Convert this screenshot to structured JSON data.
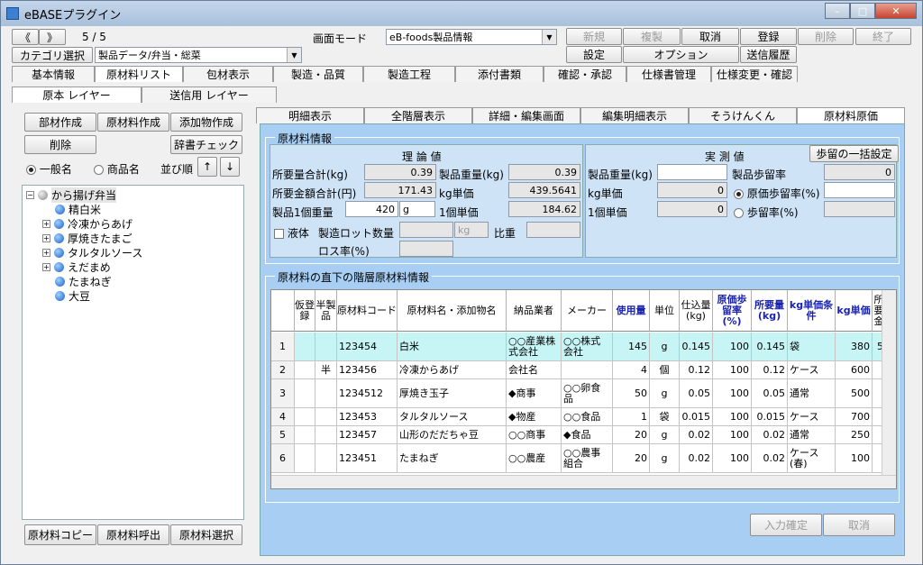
{
  "window": {
    "title": "eBASEプラグイン",
    "min": "–",
    "max": "□",
    "close": "✕"
  },
  "toolbar": {
    "prev": "《",
    "next": "》",
    "record": "5 / 5",
    "mode_label": "画面モード",
    "mode_value": "eB-foods製品情報",
    "category_btn": "カテゴリ選択",
    "category_value": "製品データ/弁当・総菜",
    "btn_new": "新規",
    "btn_copy": "複製",
    "btn_cancel": "取消",
    "btn_register": "登録",
    "btn_delete": "削除",
    "btn_exit": "終了",
    "btn_settings": "設定",
    "btn_option": "オプション",
    "btn_history": "送信履歴"
  },
  "main_tabs": [
    "基本情報",
    "原材料リスト",
    "包材表示",
    "製造・品質",
    "製造工程",
    "添付書類",
    "確認・承認",
    "仕様書管理",
    "仕様変更・確認"
  ],
  "layer_tabs": [
    "原本 レイヤー",
    "送信用 レイヤー"
  ],
  "left": {
    "btn_material": "部材作成",
    "btn_raw": "原材料作成",
    "btn_additive": "添加物作成",
    "btn_delete": "削除",
    "btn_dict": "辞書チェック",
    "radio_general": "一般名",
    "radio_product": "商品名",
    "sort_label": "並び順",
    "up": "↑",
    "down": "↓",
    "tree_root": "から揚げ弁当",
    "tree_items": [
      "精白米",
      "冷凍からあげ",
      "厚焼きたまご",
      "タルタルソース",
      "えだまめ",
      "たまねぎ",
      "大豆"
    ],
    "btn_raw_copy": "原材料コピー",
    "btn_raw_call": "原材料呼出",
    "btn_raw_select": "原材料選択"
  },
  "sub_tabs": [
    "明細表示",
    "全階層表示",
    "詳細・編集画面",
    "編集明細表示",
    "そうけんくん",
    "原材料原価"
  ],
  "info": {
    "group_title": "原材料情報",
    "theory": "理 論 値",
    "actual": "実 測 値",
    "btn_yield": "歩留の一括設定",
    "req_total_kg": "所要量合計(kg)",
    "req_total_kg_val": "0.39",
    "prod_weight_kg": "製品重量(kg)",
    "prod_weight_kg_val": "0.39",
    "req_amount": "所要金額合計(円)",
    "req_amount_val": "171.43",
    "kg_price": "kg単価",
    "kg_price_val": "439.5641",
    "unit_weight": "製品1個重量",
    "unit_weight_val": "420",
    "unit_weight_unit": "g",
    "unit_price": "1個単価",
    "unit_price_val": "184.62",
    "liquid": "液体",
    "lot": "製造ロット数量",
    "lot_unit": "kg",
    "gravity": "比重",
    "loss": "ロス率(%)",
    "a_prod_weight": "製品重量(kg)",
    "a_kg_price": "kg単価",
    "a_kg_price_val": "0",
    "a_unit_price": "1個単価",
    "a_unit_price_val": "0",
    "a_yield": "製品歩留率",
    "a_yield_val": "0",
    "a_cost_yield": "原価歩留率(%)",
    "a_yield2": "歩留率(%)"
  },
  "grid": {
    "title": "原材料の直下の階層原材料情報",
    "headers": [
      "仮登録",
      "半製品",
      "原材料コード",
      "原材料名・添加物名",
      "納品業者",
      "メーカー",
      "使用量",
      "単位",
      "仕込量(kg)",
      "原価歩留率(%)",
      "所要量(kg)",
      "kg単価条件",
      "kg単価",
      "所要金"
    ],
    "rows": [
      {
        "no": "1",
        "kari": "",
        "han": "",
        "code": "123454",
        "name": "白米",
        "vendor": "○○産業株式会社",
        "maker": "○○株式会社",
        "use": "145",
        "unit": "g",
        "shikomi": "0.145",
        "yield": "100",
        "req": "0.145",
        "cond": "袋",
        "kgp": "380",
        "amt": "5"
      },
      {
        "no": "2",
        "kari": "",
        "han": "半",
        "code": "123456",
        "name": "冷凍からあげ",
        "vendor": "会社名",
        "maker": "",
        "use": "4",
        "unit": "個",
        "shikomi": "0.12",
        "yield": "100",
        "req": "0.12",
        "cond": "ケース",
        "kgp": "600",
        "amt": ""
      },
      {
        "no": "3",
        "kari": "",
        "han": "",
        "code": "1234512",
        "name": "厚焼き玉子",
        "vendor": "◆商事",
        "maker": "○○卵食品",
        "use": "50",
        "unit": "g",
        "shikomi": "0.05",
        "yield": "100",
        "req": "0.05",
        "cond": "通常",
        "kgp": "500",
        "amt": ""
      },
      {
        "no": "4",
        "kari": "",
        "han": "",
        "code": "123453",
        "name": "タルタルソース",
        "vendor": "◆物産",
        "maker": "○○食品",
        "use": "1",
        "unit": "袋",
        "shikomi": "0.015",
        "yield": "100",
        "req": "0.015",
        "cond": "ケース",
        "kgp": "700",
        "amt": ""
      },
      {
        "no": "5",
        "kari": "",
        "han": "",
        "code": "123457",
        "name": "山形のだだちゃ豆",
        "vendor": "○○商事",
        "maker": "◆食品",
        "use": "20",
        "unit": "g",
        "shikomi": "0.02",
        "yield": "100",
        "req": "0.02",
        "cond": "通常",
        "kgp": "250",
        "amt": ""
      },
      {
        "no": "6",
        "kari": "",
        "han": "",
        "code": "123451",
        "name": "たまねぎ",
        "vendor": "○○農産",
        "maker": "○○農事組合",
        "use": "20",
        "unit": "g",
        "shikomi": "0.02",
        "yield": "100",
        "req": "0.02",
        "cond": "ケース(春)",
        "kgp": "100",
        "amt": ""
      }
    ]
  },
  "bottom": {
    "btn_confirm": "入力確定",
    "btn_cancel": "取消"
  }
}
